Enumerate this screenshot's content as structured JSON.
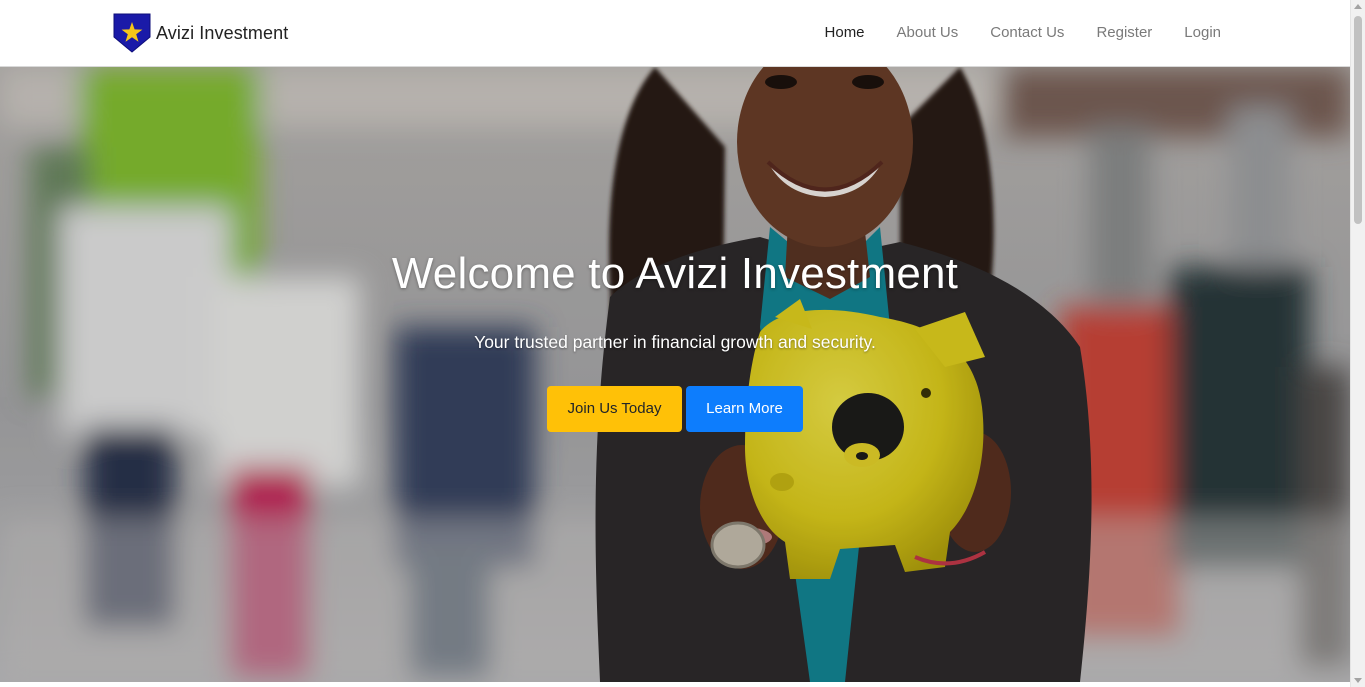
{
  "brand": {
    "name": "Avizi Investment",
    "shield_color": "#1a1aa8",
    "star_color": "#f5c518"
  },
  "nav": {
    "items": [
      {
        "label": "Home",
        "active": true
      },
      {
        "label": "About Us",
        "active": false
      },
      {
        "label": "Contact Us",
        "active": false
      },
      {
        "label": "Register",
        "active": false
      },
      {
        "label": "Login",
        "active": false
      }
    ]
  },
  "hero": {
    "title": "Welcome to Avizi Investment",
    "subtitle": "Your trusted partner in financial growth and security.",
    "primary_button": "Join Us Today",
    "secondary_button": "Learn More",
    "primary_color": "#ffc107",
    "secondary_color": "#0d7dfd"
  }
}
